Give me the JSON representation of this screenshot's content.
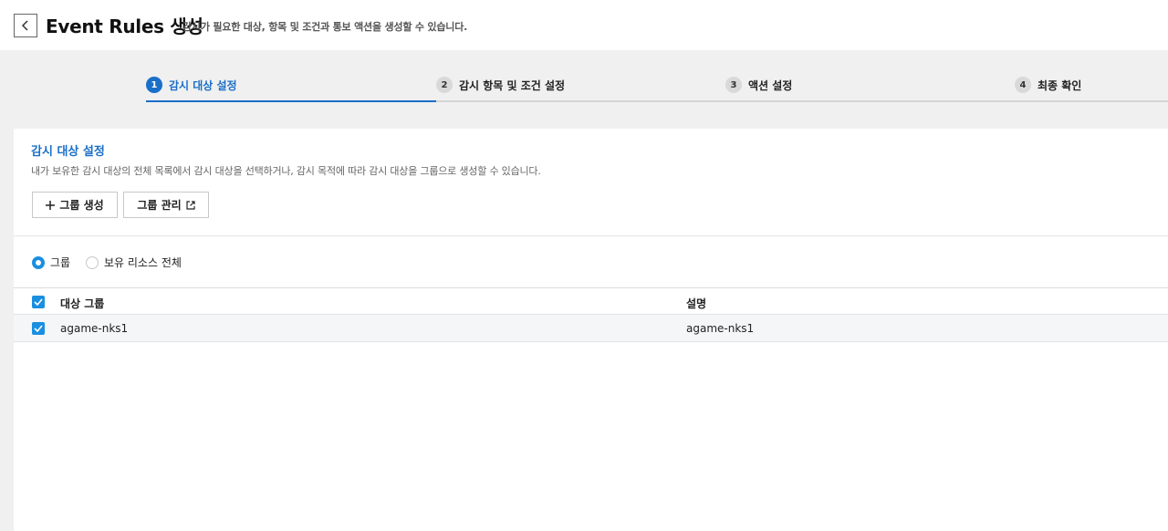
{
  "header": {
    "title": "Event Rules 생성",
    "subtitle": "감시가 필요한 대상, 항목 및 조건과 통보 액션을 생성할 수 있습니다."
  },
  "stepper": {
    "steps": [
      {
        "number": "1",
        "label": "감시 대상 설정"
      },
      {
        "number": "2",
        "label": "감시 항목 및 조건 설정"
      },
      {
        "number": "3",
        "label": "액션 설정"
      },
      {
        "number": "4",
        "label": "최종 확인"
      }
    ],
    "active_step": 1
  },
  "section": {
    "title": "감시 대상 설정",
    "description": "내가 보유한 감시 대상의 전체 목록에서 감시 대상을 선택하거나, 감시 목적에 따라 감시 대상을 그룹으로 생성할 수 있습니다."
  },
  "buttons": {
    "create_group": "그룹 생성",
    "manage_group": "그룹 관리"
  },
  "radio": {
    "options": [
      "그룹",
      "보유 리소스 전체"
    ],
    "selected": "그룹"
  },
  "table": {
    "headers": [
      "대상 그룹",
      "설명"
    ],
    "rows": [
      {
        "group": "agame-nks1",
        "description": "agame-nks1",
        "checked": true
      }
    ]
  },
  "colors": {
    "accent": "#1a6fc9",
    "checkbox": "#1a8fe0"
  }
}
